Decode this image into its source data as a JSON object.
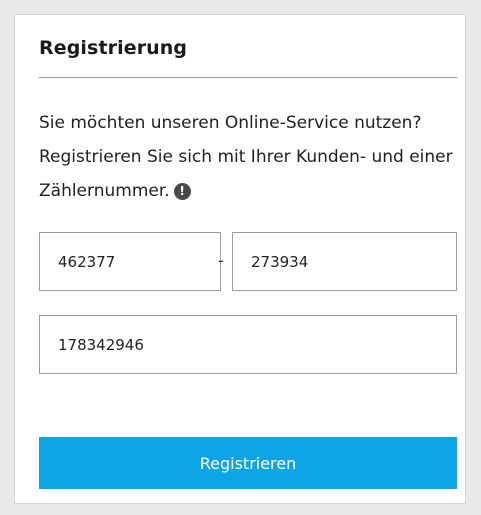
{
  "card": {
    "title": "Registrierung",
    "intro": "Sie möchten unseren Online-Service nutzen? Registrieren Sie sich mit Ihrer Kunden- und einer Zählernummer.",
    "info_icon_glyph": "!"
  },
  "form": {
    "kundennummer": "462377",
    "separator": "-",
    "zaehlernummer_part1": "273934",
    "zaehlernummer_part2": "178342946",
    "submit_label": "Registrieren"
  },
  "colors": {
    "button_background": "#0ea5e6",
    "page_background": "#e9e9e9"
  }
}
